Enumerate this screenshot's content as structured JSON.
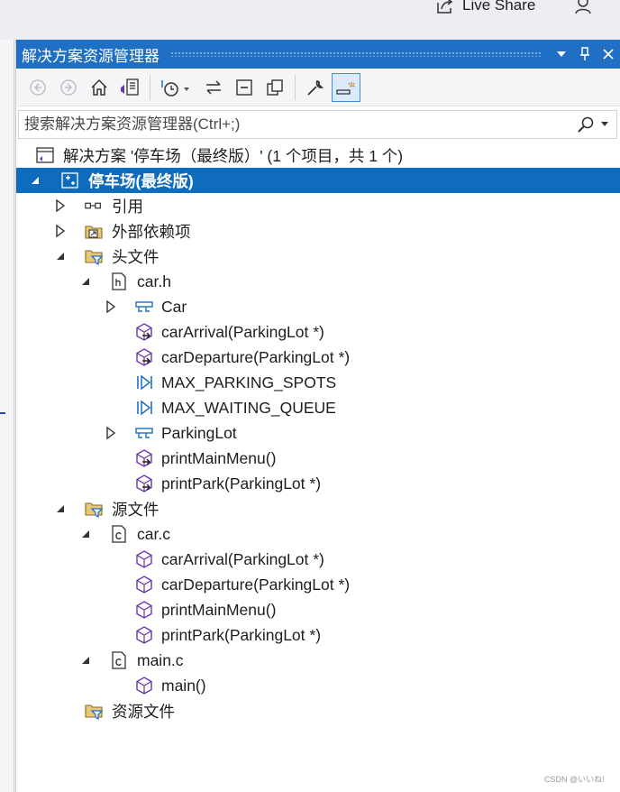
{
  "topbar": {
    "live_share_label": "Live Share"
  },
  "panel": {
    "title": "解决方案资源管理器",
    "search_placeholder": "搜索解决方案资源管理器(Ctrl+;)"
  },
  "tree": {
    "solution": "解决方案 '停车场（最终版）' (1 个项目，共 1 个)",
    "project": "停车场(最终版)",
    "references": "引用",
    "external_deps": "外部依赖项",
    "header_files": "头文件",
    "car_h": "car.h",
    "car_h_items": {
      "car": "Car",
      "carArrival": "carArrival(ParkingLot *)",
      "carDeparture": "carDeparture(ParkingLot *)",
      "max_parking": "MAX_PARKING_SPOTS",
      "max_waiting": "MAX_WAITING_QUEUE",
      "parkinglot": "ParkingLot",
      "printMainMenu": "printMainMenu()",
      "printPark": "printPark(ParkingLot *)"
    },
    "source_files": "源文件",
    "car_c": "car.c",
    "car_c_items": {
      "carArrival": "carArrival(ParkingLot *)",
      "carDeparture": "carDeparture(ParkingLot *)",
      "printMainMenu": "printMainMenu()",
      "printPark": "printPark(ParkingLot *)"
    },
    "main_c": "main.c",
    "main_c_items": {
      "main": "main()"
    },
    "resource_files": "资源文件"
  },
  "watermark": "CSDN @いいね!",
  "colors": {
    "title_bar": "#1f6fc4",
    "selection": "#0f6cbd",
    "method_purple": "#6936aa",
    "folder_gold": "#c89a3a",
    "struct_blue": "#1f6fc4"
  }
}
